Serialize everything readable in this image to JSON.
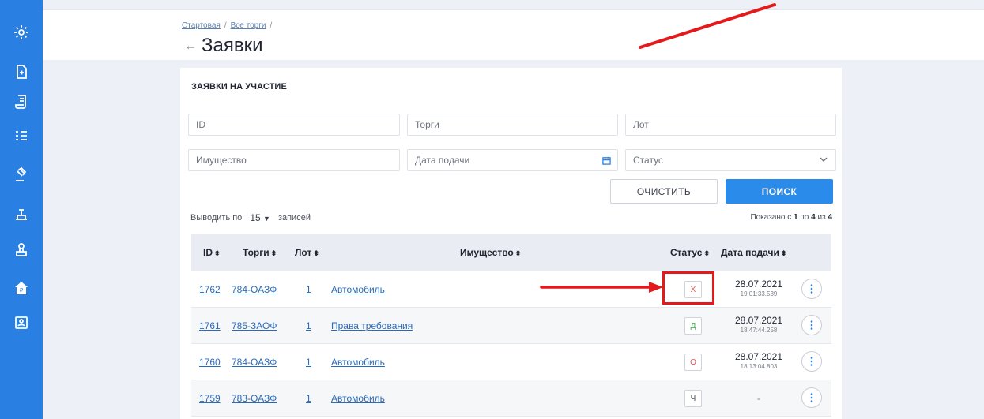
{
  "breadcrumb": [
    "Стартовая",
    "Все торги"
  ],
  "page": {
    "title": "Заявки"
  },
  "card": {
    "title": "ЗАЯВКИ НА УЧАСТИЕ"
  },
  "filters": {
    "id_placeholder": "ID",
    "auction_placeholder": "Торги",
    "lot_placeholder": "Лот",
    "property_placeholder": "Имущество",
    "date_placeholder": "Дата подачи",
    "status_placeholder": "Статус"
  },
  "buttons": {
    "clear": "ОЧИСТИТЬ",
    "search": "ПОИСК"
  },
  "pagination": {
    "prefix": "Выводить по",
    "per_page": "15",
    "suffix": "записей",
    "shown_prefix": "Показано с",
    "from": "1",
    "to_word": "по",
    "to": "4",
    "of_word": "из",
    "total": "4"
  },
  "table": {
    "columns": [
      "ID",
      "Торги",
      "Лот",
      "Имущество",
      "Статус",
      "Дата подачи"
    ],
    "sort_glyph": "⬍",
    "rows": [
      {
        "id": "1762",
        "auction": "784-ОАЗФ",
        "lot": "1",
        "property": "Автомобиль",
        "status": "Х",
        "status_color": "#e2575a",
        "date": "28.07.2021",
        "time": "19:01:33.539"
      },
      {
        "id": "1761",
        "auction": "785-ЗАОФ",
        "lot": "1",
        "property": "Права требования",
        "status": "Д",
        "status_color": "#3caa4f",
        "date": "28.07.2021",
        "time": "18:47:44.258"
      },
      {
        "id": "1760",
        "auction": "784-ОАЗФ",
        "lot": "1",
        "property": "Автомобиль",
        "status": "О",
        "status_color": "#e2575a",
        "date": "28.07.2021",
        "time": "18:13:04.803"
      },
      {
        "id": "1759",
        "auction": "783-ОАЗФ",
        "lot": "1",
        "property": "Автомобиль",
        "status": "Ч",
        "status_color": "#4a4f5a",
        "date": "-",
        "time": ""
      }
    ]
  },
  "sidebar": {
    "icons": [
      "gear-icon",
      "document-icon",
      "scroll-icon",
      "list-icon",
      "gavel-icon",
      "pen-tool-icon",
      "stamp-icon",
      "ruble-house-icon",
      "contacts-icon"
    ]
  },
  "colors": {
    "accent": "#2a7fe3",
    "annotation_red": "#e3191c"
  }
}
